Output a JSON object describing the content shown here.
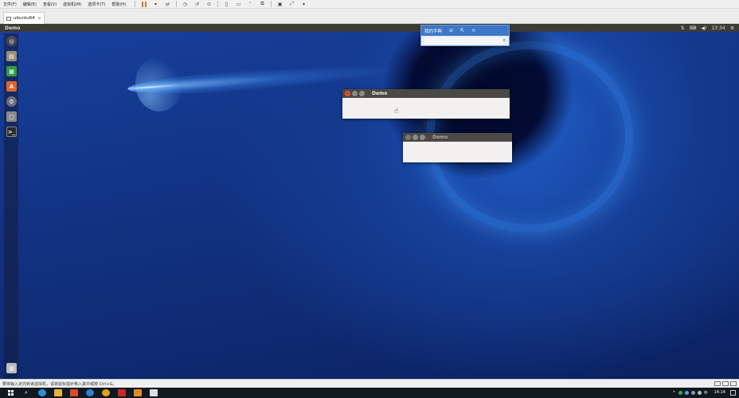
{
  "vmware": {
    "menu": [
      "文件(F)",
      "编辑(E)",
      "查看(V)",
      "虚拟机(M)",
      "选项卡(T)",
      "帮助(H)"
    ],
    "tab_label": "ubuntu64",
    "tab_close": "×",
    "status_text": "要将输入定向到该虚拟机，请将鼠标指针移入其中或按 Ctrl+G。"
  },
  "ubuntu": {
    "panel_title": "Demo",
    "panel_time": "13:34",
    "launcher": [
      "dash",
      "files",
      "libreoffice-calc",
      "software-center",
      "system-settings",
      "app",
      "terminal",
      "trash"
    ]
  },
  "search_popup": {
    "title": "我的字典",
    "input_value": "",
    "buttons": [
      "⊖",
      "⇱",
      "×"
    ]
  },
  "windows": [
    {
      "title": "Demo",
      "active": true
    },
    {
      "title": "Demo",
      "active": false
    }
  ],
  "taskbar": {
    "time": "14:14",
    "date": ""
  },
  "colors": {
    "ubuntu_panel": "#3c3b37",
    "close_button": "#e4572e",
    "search_header": "#3d78c8",
    "taskbar": "#101820"
  }
}
